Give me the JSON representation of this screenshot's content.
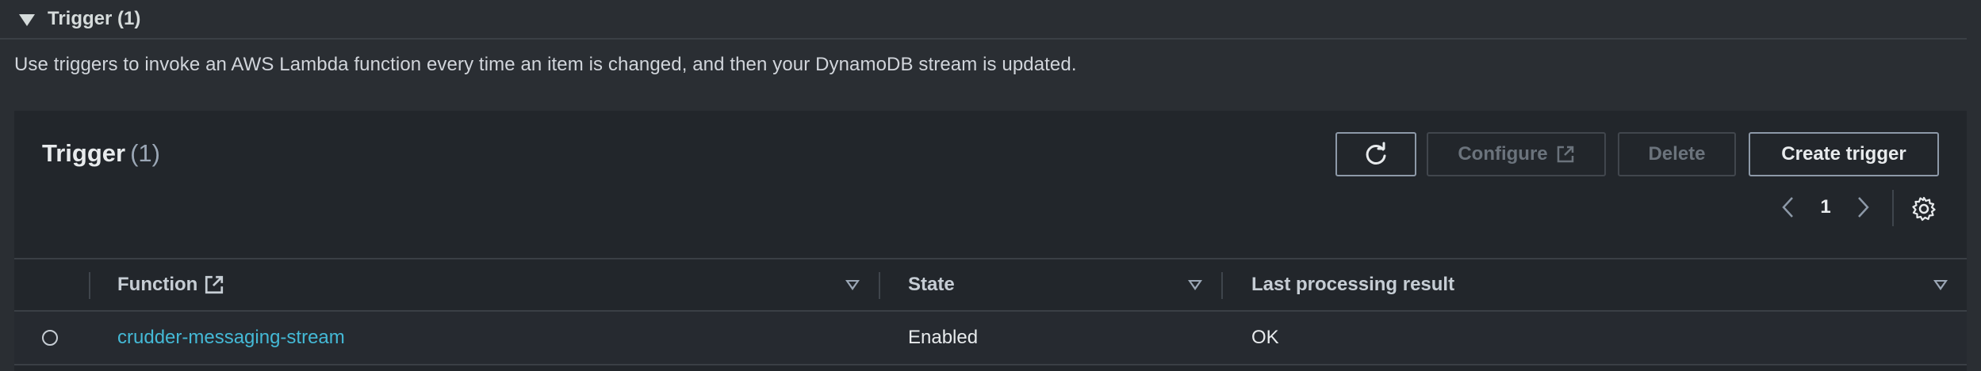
{
  "section": {
    "title": "Trigger (1)",
    "description": "Use triggers to invoke an AWS Lambda function every time an item is changed, and then your DynamoDB stream is updated."
  },
  "panel": {
    "title": "Trigger",
    "count": "(1)",
    "buttons": {
      "refresh_icon": "refresh-icon",
      "configure": "Configure",
      "delete": "Delete",
      "create": "Create trigger"
    },
    "pagination": {
      "current_page": "1"
    }
  },
  "table": {
    "columns": [
      "Function",
      "State",
      "Last processing result"
    ],
    "rows": [
      {
        "function": "crudder-messaging-stream",
        "state": "Enabled",
        "last_result": "OK"
      }
    ]
  },
  "colors": {
    "background": "#2a2e33",
    "panel": "#22262b",
    "link": "#44b9d6"
  }
}
